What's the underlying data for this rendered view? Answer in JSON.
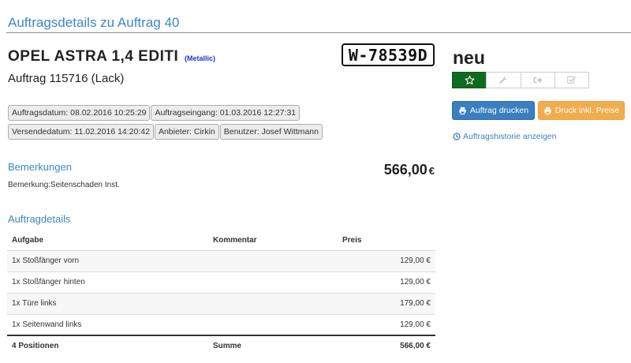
{
  "header": {
    "title": "Auftragsdetails zu Auftrag 40"
  },
  "vehicle": {
    "name": "OPEL ASTRA 1,4 EDITI",
    "paint": "(Metallic)",
    "plate": "W-78539D"
  },
  "order": {
    "label": "Auftrag 115716 (Lack)"
  },
  "info_tags": [
    "Auftragsdatum: 08.02.2016 10:25:29",
    "Auftragseingang: 01.03.2016 12:27:31",
    "Versendedatum: 11.02.2016 14:20:42",
    "Anbieter: Cirkin",
    "Benutzer: Josef Wittmann"
  ],
  "status": {
    "label": "neu",
    "buttons": [
      {
        "icon": "star-icon",
        "active": true
      },
      {
        "icon": "wrench-icon",
        "active": false
      },
      {
        "icon": "sign-out-icon",
        "active": false
      },
      {
        "icon": "check-square-icon",
        "active": false
      }
    ],
    "active_color": "#0f6b1f"
  },
  "actions": {
    "print_label": "Auftrag drucken",
    "print_prices_label": "Druck inkl. Preise",
    "history_label": "Auftragshistorie anzeigen",
    "print_color": "#3a7fc1",
    "print_prices_color": "#f0ad4e"
  },
  "remarks": {
    "heading": "Bemerkungen",
    "text": "Bemerkung:Seitenschaden Inst."
  },
  "total": {
    "amount": "566,00",
    "currency": "€"
  },
  "details": {
    "heading": "Auftragdetails",
    "columns": [
      "Aufgabe",
      "Kommentar",
      "Preis"
    ],
    "rows": [
      {
        "task": "1x Stoßfänger vorn",
        "comment": "",
        "price": "129,00 €"
      },
      {
        "task": "1x Stoßfänger hinten",
        "comment": "",
        "price": "129,00 €"
      },
      {
        "task": "1x Türe links",
        "comment": "",
        "price": "179,00 €"
      },
      {
        "task": "1x Seitenwand links",
        "comment": "",
        "price": "129,00 €"
      }
    ],
    "footer": {
      "positions": "4 Positionen",
      "sum_label": "Summe",
      "sum_value": "566,00 €"
    }
  }
}
